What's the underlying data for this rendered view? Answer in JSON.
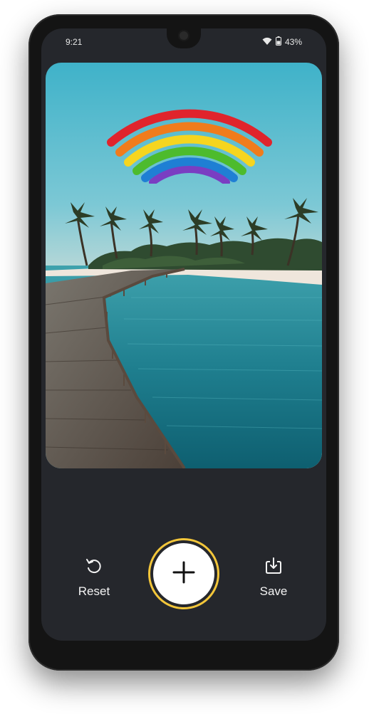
{
  "status_bar": {
    "time": "9:21",
    "battery_percent": "43%",
    "icons": [
      "wifi-icon",
      "battery-icon"
    ]
  },
  "editor": {
    "photo_subject": "tropical beach boardwalk",
    "sticker": "rainbow"
  },
  "controls": {
    "reset_label": "Reset",
    "save_label": "Save",
    "add_button_icon": "plus-icon",
    "accent_color": "#f3c63a"
  }
}
